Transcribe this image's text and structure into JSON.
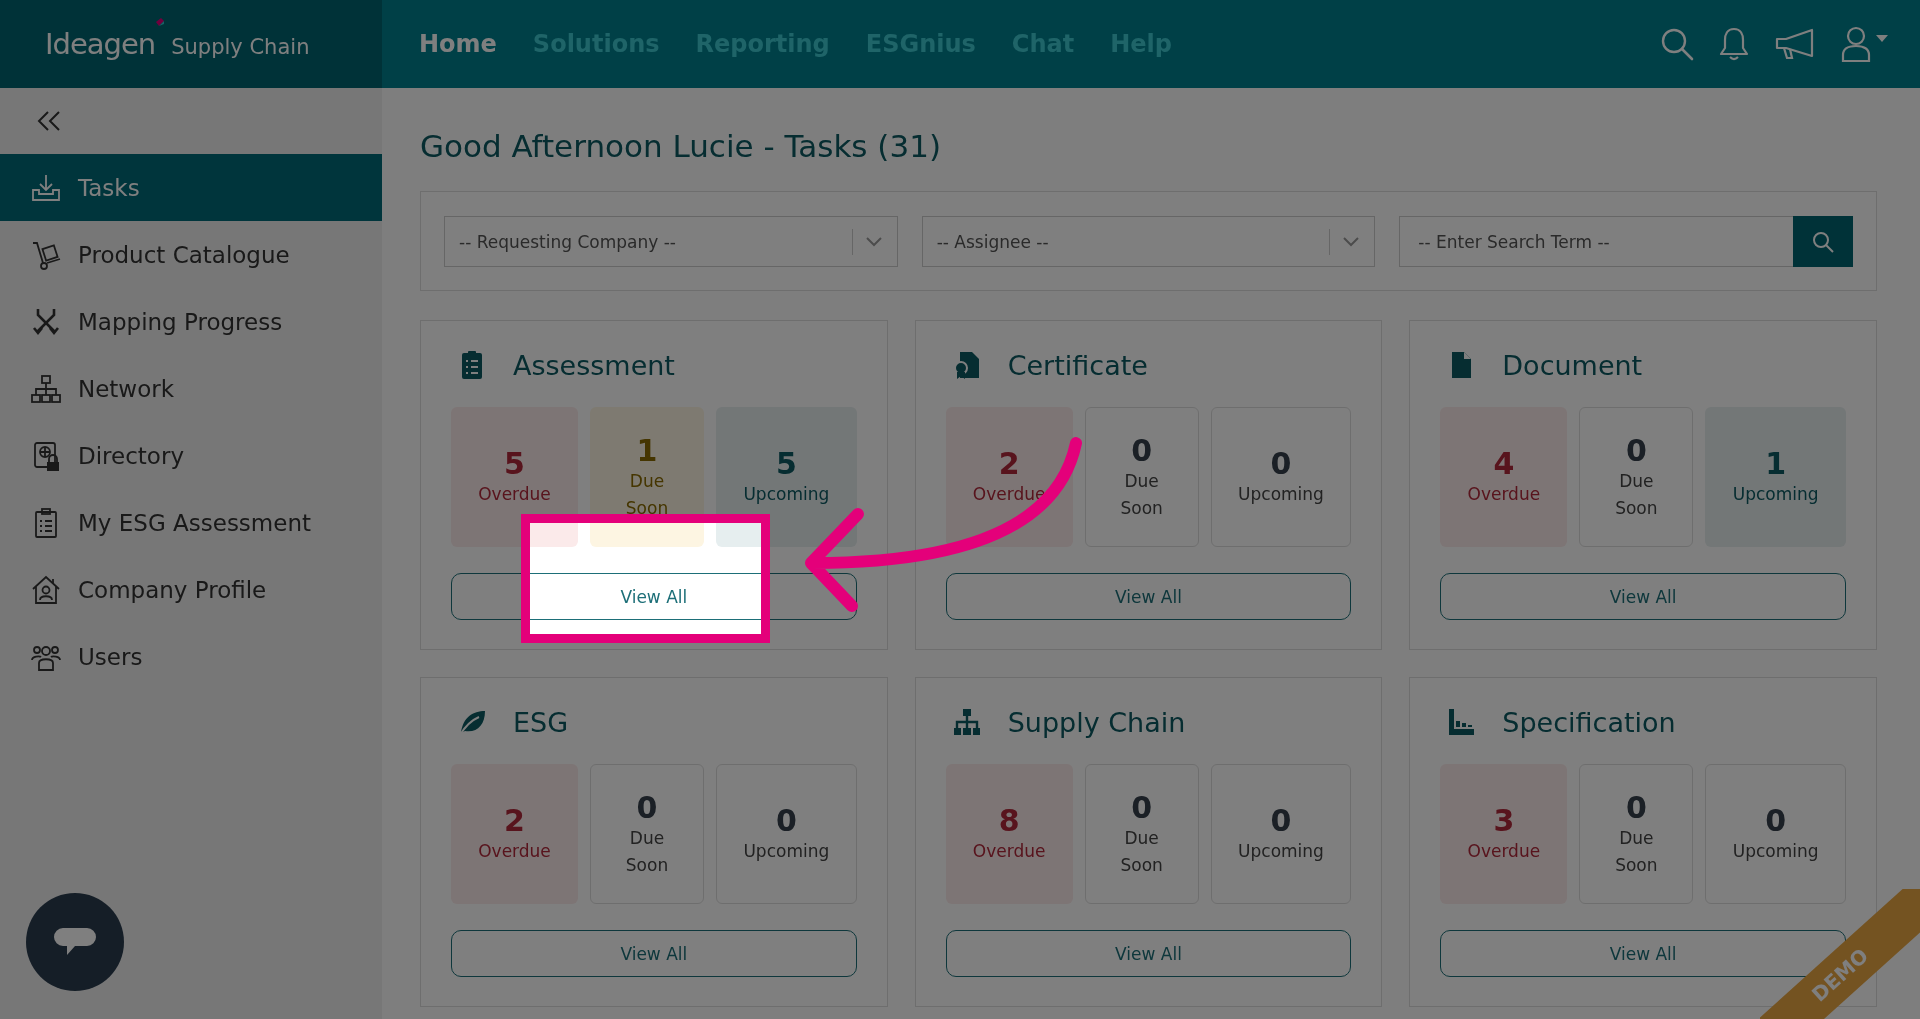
{
  "header": {
    "logo": {
      "brand": "Ideagen",
      "product": "Supply Chain"
    },
    "nav": [
      {
        "label": "Home",
        "selected": true
      },
      {
        "label": "Solutions",
        "selected": false
      },
      {
        "label": "Reporting",
        "selected": false
      },
      {
        "label": "ESGnius",
        "selected": false
      },
      {
        "label": "Chat",
        "selected": false
      },
      {
        "label": "Help",
        "selected": false
      }
    ]
  },
  "sidebar": {
    "items": [
      {
        "label": "Tasks",
        "selected": true
      },
      {
        "label": "Product Catalogue",
        "selected": false
      },
      {
        "label": "Mapping Progress",
        "selected": false
      },
      {
        "label": "Network",
        "selected": false
      },
      {
        "label": "Directory",
        "selected": false
      },
      {
        "label": "My ESG Assessment",
        "selected": false
      },
      {
        "label": "Company Profile",
        "selected": false
      },
      {
        "label": "Users",
        "selected": false
      }
    ]
  },
  "page": {
    "title": "Good Afternoon Lucie - Tasks (31)"
  },
  "filters": {
    "requesting_company": {
      "prompt": "-- Requesting Company --"
    },
    "assignee": {
      "prompt": "-- Assignee --"
    },
    "search": {
      "placeholder": "-- Enter Search Term --"
    }
  },
  "cards": [
    {
      "title": "Assessment",
      "highlighted": true,
      "tiles": [
        {
          "kind": "overdue",
          "count": "5",
          "label": "Overdue",
          "active": true
        },
        {
          "kind": "due_soon",
          "count": "1",
          "label": "Due Soon",
          "active": true
        },
        {
          "kind": "upcoming",
          "count": "5",
          "label": "Upcoming",
          "active": true
        }
      ],
      "button": "View All"
    },
    {
      "title": "Certificate",
      "highlighted": false,
      "tiles": [
        {
          "kind": "overdue",
          "count": "2",
          "label": "Overdue",
          "active": true
        },
        {
          "kind": "due_soon",
          "count": "0",
          "label": "Due Soon",
          "active": false
        },
        {
          "kind": "upcoming",
          "count": "0",
          "label": "Upcoming",
          "active": false
        }
      ],
      "button": "View All"
    },
    {
      "title": "Document",
      "highlighted": false,
      "tiles": [
        {
          "kind": "overdue",
          "count": "4",
          "label": "Overdue",
          "active": true
        },
        {
          "kind": "due_soon",
          "count": "0",
          "label": "Due Soon",
          "active": false
        },
        {
          "kind": "upcoming",
          "count": "1",
          "label": "Upcoming",
          "active": true
        }
      ],
      "button": "View All"
    },
    {
      "title": "ESG",
      "highlighted": false,
      "tiles": [
        {
          "kind": "overdue",
          "count": "2",
          "label": "Overdue",
          "active": true
        },
        {
          "kind": "due_soon",
          "count": "0",
          "label": "Due Soon",
          "active": false
        },
        {
          "kind": "upcoming",
          "count": "0",
          "label": "Upcoming",
          "active": false
        }
      ],
      "button": "View All"
    },
    {
      "title": "Supply Chain",
      "highlighted": false,
      "tiles": [
        {
          "kind": "overdue",
          "count": "8",
          "label": "Overdue",
          "active": true
        },
        {
          "kind": "due_soon",
          "count": "0",
          "label": "Due Soon",
          "active": false
        },
        {
          "kind": "upcoming",
          "count": "0",
          "label": "Upcoming",
          "active": false
        }
      ],
      "button": "View All"
    },
    {
      "title": "Specification",
      "highlighted": false,
      "tiles": [
        {
          "kind": "overdue",
          "count": "3",
          "label": "Overdue",
          "active": true
        },
        {
          "kind": "due_soon",
          "count": "0",
          "label": "Due Soon",
          "active": false
        },
        {
          "kind": "upcoming",
          "count": "0",
          "label": "Upcoming",
          "active": false
        }
      ],
      "button": "View All"
    }
  ],
  "demo_ribbon": "DEMO"
}
